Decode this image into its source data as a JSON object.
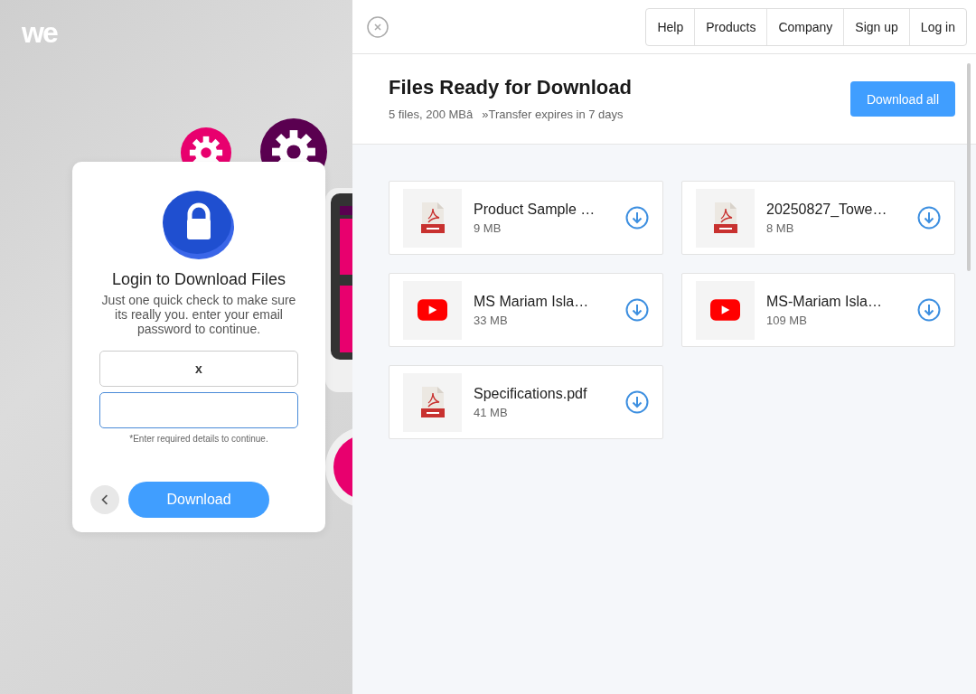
{
  "logo": "we",
  "login": {
    "title": "Login to Download Files",
    "message": "Just one quick check to make sure its really you. enter your email password to continue.",
    "email": {
      "value": "x",
      "focused": false
    },
    "password": {
      "focused": true
    },
    "note": "*Enter required details to continue.",
    "button": "Download"
  },
  "nav": [
    "Help",
    "Products",
    "Company",
    "Sign up",
    "Log in"
  ],
  "transfer": {
    "title": "Files Ready for Download",
    "summary": "5 files, 200 MBâ»Transfer expires in 7 days",
    "button": "Download all"
  },
  "files": [
    {
      "name": "Product Sample …",
      "size": "9 MB",
      "kind": "pdf"
    },
    {
      "name": "20250827_Towe…",
      "size": "8 MB",
      "kind": "pdf"
    },
    {
      "name": "MS Mariam Isla…",
      "size": "33 MB",
      "kind": "video"
    },
    {
      "name": "MS-Mariam Isla…",
      "size": "109 MB",
      "kind": "video"
    },
    {
      "name": "Specifications.pdf",
      "size": "41 MB",
      "kind": "pdf"
    }
  ]
}
